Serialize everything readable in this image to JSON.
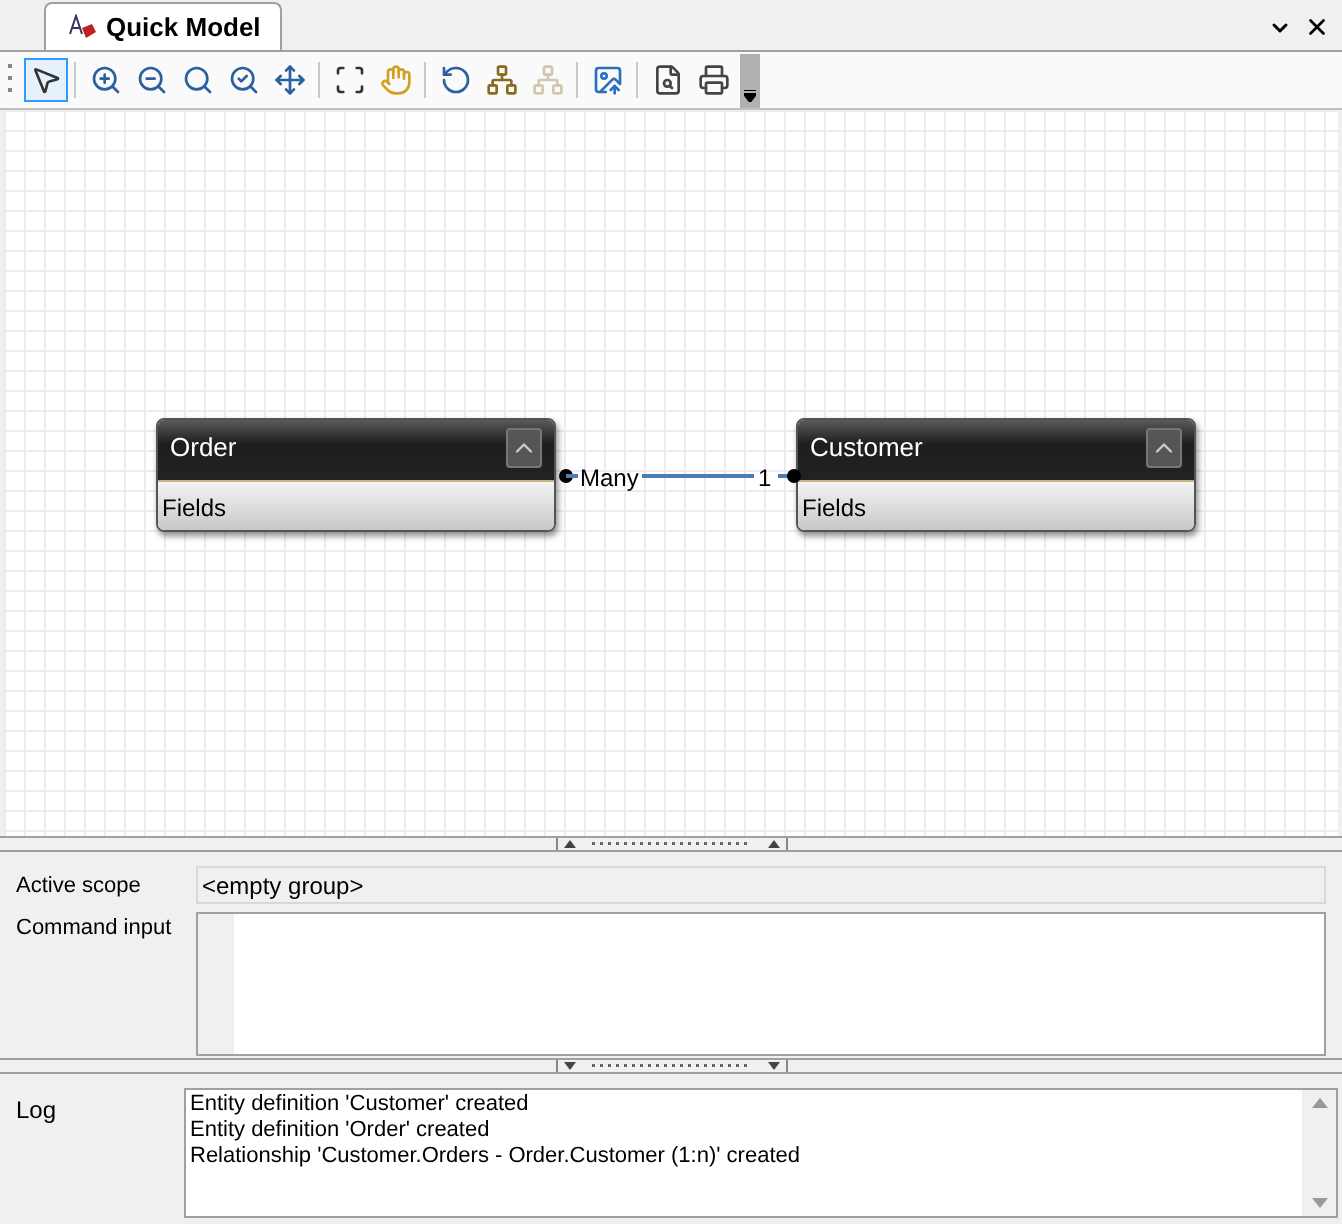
{
  "tab": {
    "label": "Quick Model",
    "selected": true
  },
  "toolbar": [
    {
      "kind": "pointer",
      "selected": true,
      "disabled": false
    },
    {
      "kind": "zoom-in",
      "selected": false,
      "disabled": false
    },
    {
      "kind": "zoom-out",
      "selected": false,
      "disabled": false
    },
    {
      "kind": "zoom-area",
      "selected": false,
      "disabled": false
    },
    {
      "kind": "zoom-actual",
      "selected": false,
      "disabled": false
    },
    {
      "kind": "zoom-fit",
      "selected": false,
      "disabled": false
    },
    {
      "kind": "fit-frame",
      "selected": false,
      "disabled": false
    },
    {
      "kind": "hand",
      "selected": false,
      "disabled": false
    },
    {
      "kind": "refresh",
      "selected": false,
      "disabled": false
    },
    {
      "kind": "hierarchy",
      "selected": false,
      "disabled": false
    },
    {
      "kind": "hierarchy",
      "selected": false,
      "disabled": true
    },
    {
      "kind": "export",
      "selected": false,
      "disabled": false
    },
    {
      "kind": "preview",
      "selected": false,
      "disabled": false
    },
    {
      "kind": "print",
      "selected": false,
      "disabled": false
    }
  ],
  "entities": [
    {
      "name": "Order",
      "section": "Fields"
    },
    {
      "name": "Customer",
      "section": "Fields"
    }
  ],
  "relationship": {
    "from_label": "Many",
    "to_label": "1"
  },
  "active_scope": {
    "label": "Active scope",
    "value": "<empty group>"
  },
  "command_input": {
    "label": "Command input"
  },
  "log": {
    "label": "Log",
    "lines": [
      "Entity definition 'Customer' created",
      "Entity definition 'Order' created",
      "Relationship 'Customer.Orders - Order.Customer (1:n)' created"
    ]
  }
}
